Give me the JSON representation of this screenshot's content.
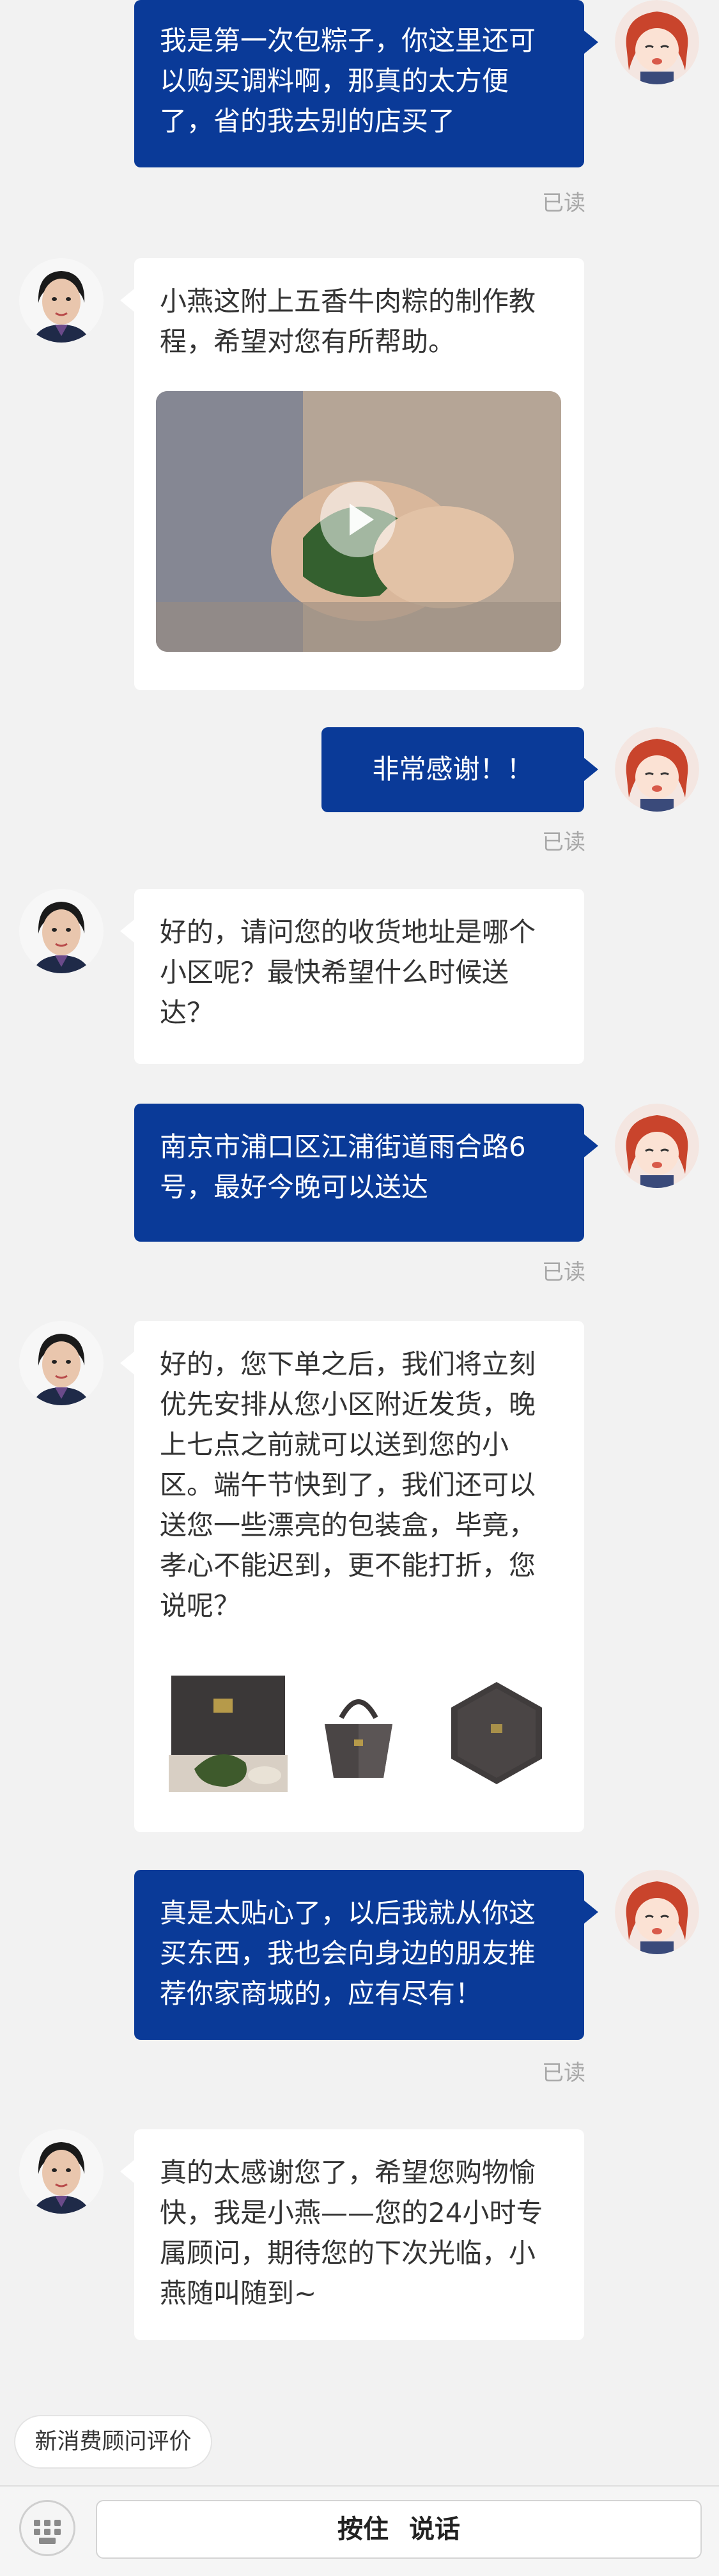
{
  "colors": {
    "user_bubble": "#0a3a98",
    "agent_bubble": "#ffffff",
    "background": "#f2f2f2",
    "read_text": "#a8a8a8"
  },
  "messages": [
    {
      "sender": "user",
      "text": "我是第一次包粽子，你这里还可以购买调料啊，那真的太方便了，省的我去别的店买了",
      "status": "已读"
    },
    {
      "sender": "agent",
      "text": "小燕这附上五香牛肉粽的制作教程，希望对您有所帮助。",
      "attachment": "video"
    },
    {
      "sender": "user",
      "text": "非常感谢！！",
      "status": "已读"
    },
    {
      "sender": "agent",
      "text": "好的，请问您的收货地址是哪个小区呢？最快希望什么时候送达？"
    },
    {
      "sender": "user",
      "text": "南京市浦口区江浦街道雨合路6号，最好今晚可以送达",
      "status": "已读"
    },
    {
      "sender": "agent",
      "text": "好的，您下单之后，我们将立刻优先安排从您小区附近发货，晚上七点之前就可以送到您的小区。端午节快到了，我们还可以送您一些漂亮的包装盒，毕竟，孝心不能迟到，更不能打折，您说呢？",
      "attachment": "products"
    },
    {
      "sender": "user",
      "text": "真是太贴心了，以后我就从你这买东西，我也会向身边的朋友推荐你家商城的，应有尽有！",
      "status": "已读"
    },
    {
      "sender": "agent",
      "text": "真的太感谢您了，希望您购物愉快，我是小燕——您的24小时专属顾问，期待您的下次光临，小燕随叫随到~"
    }
  ],
  "evaluation_button": "新消费顾问评价",
  "input_bar": {
    "hold_to_talk": "按住 说话",
    "keyboard_icon": "keyboard-icon"
  }
}
